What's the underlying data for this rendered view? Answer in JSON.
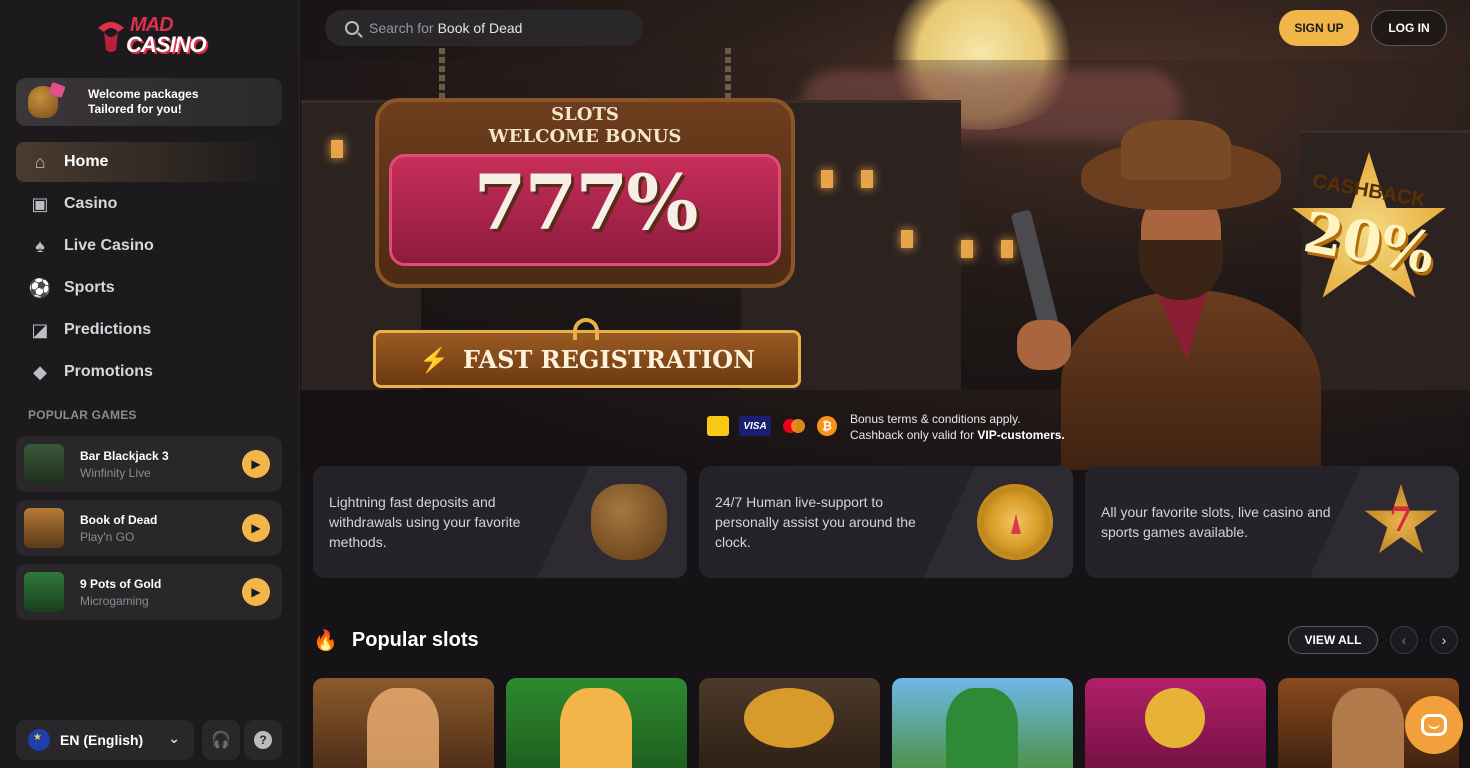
{
  "brand": {
    "logo_top": "MAD",
    "logo_bottom": "CASINO"
  },
  "welcome": {
    "line1": "Welcome packages",
    "line2": "Tailored for you!"
  },
  "nav": [
    {
      "label": "Home",
      "icon": "home-icon"
    },
    {
      "label": "Casino",
      "icon": "slot-machine-icon"
    },
    {
      "label": "Live Casino",
      "icon": "cards-icon"
    },
    {
      "label": "Sports",
      "icon": "soccer-ball-icon"
    },
    {
      "label": "Predictions",
      "icon": "predictions-icon"
    },
    {
      "label": "Promotions",
      "icon": "diamond-icon"
    }
  ],
  "popular_games": {
    "heading": "POPULAR GAMES",
    "items": [
      {
        "title": "Bar Blackjack 3",
        "provider": "Winfinity Live"
      },
      {
        "title": "Book of Dead",
        "provider": "Play'n GO"
      },
      {
        "title": "9 Pots of Gold",
        "provider": "Microgaming"
      }
    ]
  },
  "footer": {
    "language": "EN (English)"
  },
  "search": {
    "prefix": "Search for",
    "highlight": "Book of Dead"
  },
  "header": {
    "signup": "SIGN UP",
    "login": "LOG IN"
  },
  "hero": {
    "sign_line1": "SLOTS",
    "sign_line2": "WELCOME BONUS",
    "bonus": "777%",
    "cta": "FAST REGISTRATION",
    "cashback_label": "CASHBACK",
    "cashback_value": "20%",
    "terms_line1": "Bonus terms & conditions apply.",
    "terms_line2_prefix": "Cashback only valid for",
    "terms_line2_bold": "VIP-customers."
  },
  "payments": [
    "Interac",
    "VISA",
    "Mastercard",
    "₿"
  ],
  "features": [
    "Lightning fast deposits and withdrawals using your favorite methods.",
    "24/7 Human live-support to personally assist you around the clock.",
    "All your favorite slots, live casino and sports games available."
  ],
  "slots": {
    "title": "Popular slots",
    "view_all": "VIEW ALL"
  },
  "colors": {
    "accent": "#f2b54a",
    "brand_red": "#e0314b",
    "sidebar_bg": "#1c1a1d",
    "main_bg": "#151316"
  }
}
